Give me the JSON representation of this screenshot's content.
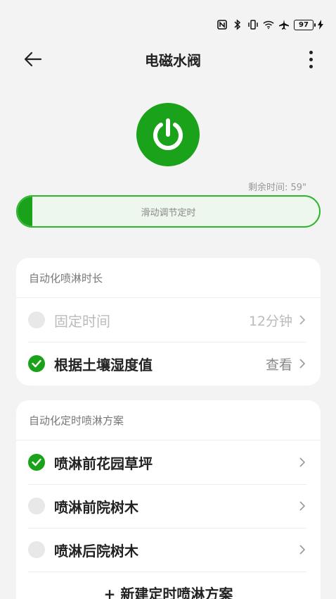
{
  "status_bar": {
    "battery": "97",
    "icons": [
      "nfc-icon",
      "bluetooth-icon",
      "vibrate-icon",
      "wifi-icon",
      "airplane-icon",
      "charging-icon"
    ]
  },
  "app_bar": {
    "title": "电磁水阀"
  },
  "power": {
    "state": "on",
    "color": "#1aa21a"
  },
  "timer": {
    "remaining_text": "剩余时间: 59\"",
    "slider_label": "滑动调节定时",
    "slider_level": 0.05
  },
  "duration_card": {
    "header": "自动化喷淋时长",
    "items": [
      {
        "label": "固定时间",
        "value": "12分钟",
        "checked": false,
        "disabled": true
      },
      {
        "label": "根据土壤湿度值",
        "value": "查看",
        "checked": true,
        "disabled": false
      }
    ]
  },
  "schedule_card": {
    "header": "自动化定时喷淋方案",
    "items": [
      {
        "label": "喷淋前花园草坪",
        "checked": true
      },
      {
        "label": "喷淋前院树木",
        "checked": false
      },
      {
        "label": "喷淋后院树木",
        "checked": false
      }
    ],
    "new_plan": "+ 新建定时喷淋方案"
  },
  "colors": {
    "accent": "#1aa21a",
    "background": "#f3f3f3"
  }
}
